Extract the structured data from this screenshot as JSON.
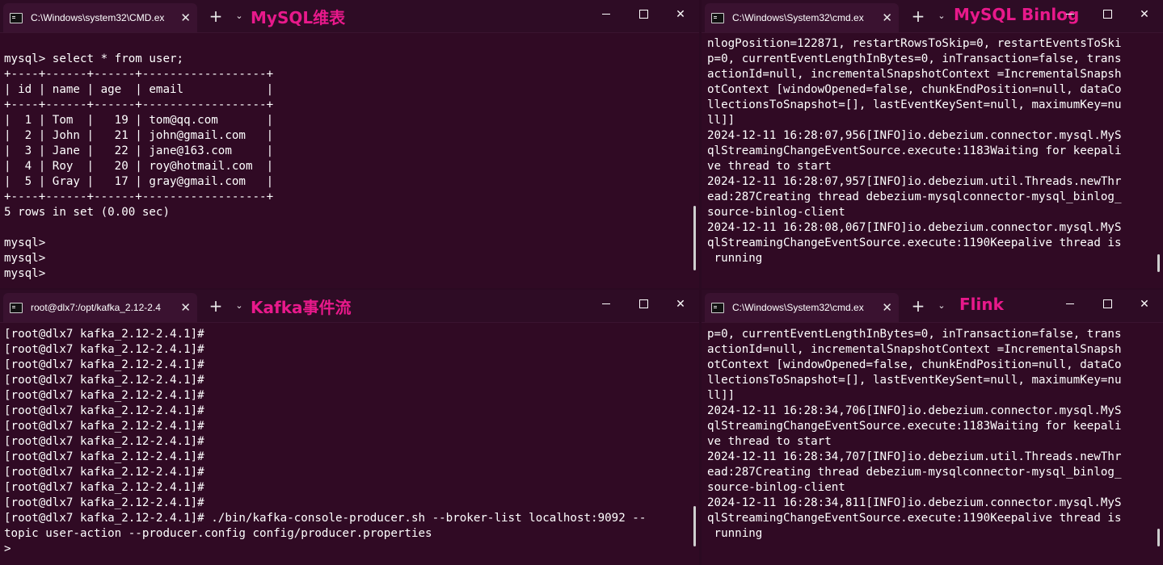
{
  "windows": {
    "mysql": {
      "tab_title": "C:\\Windows\\system32\\CMD.ex",
      "annotation": "MySQL维表",
      "console_lines": [
        "",
        "mysql> select * from user;",
        "+----+------+------+------------------+",
        "| id | name | age  | email            |",
        "+----+------+------+------------------+",
        "|  1 | Tom  |   19 | tom@qq.com       |",
        "|  2 | John |   21 | john@gmail.com   |",
        "|  3 | Jane |   22 | jane@163.com     |",
        "|  4 | Roy  |   20 | roy@hotmail.com  |",
        "|  5 | Gray |   17 | gray@gmail.com   |",
        "+----+------+------+------------------+",
        "5 rows in set (0.00 sec)",
        "",
        "mysql>",
        "mysql>",
        "mysql>"
      ]
    },
    "binlog": {
      "tab_title": "C:\\Windows\\System32\\cmd.ex",
      "annotation": "MySQL Binlog",
      "console_lines": [
        "nlogPosition=122871, restartRowsToSkip=0, restartEventsToSki",
        "p=0, currentEventLengthInBytes=0, inTransaction=false, trans",
        "actionId=null, incrementalSnapshotContext =IncrementalSnapsh",
        "otContext [windowOpened=false, chunkEndPosition=null, dataCo",
        "llectionsToSnapshot=[], lastEventKeySent=null, maximumKey=nu",
        "ll]]",
        "2024-12-11 16:28:07,956[INFO]io.debezium.connector.mysql.MyS",
        "qlStreamingChangeEventSource.execute:1183Waiting for keepali",
        "ve thread to start",
        "2024-12-11 16:28:07,957[INFO]io.debezium.util.Threads.newThr",
        "ead:287Creating thread debezium-mysqlconnector-mysql_binlog_",
        "source-binlog-client",
        "2024-12-11 16:28:08,067[INFO]io.debezium.connector.mysql.MyS",
        "qlStreamingChangeEventSource.execute:1190Keepalive thread is",
        " running"
      ]
    },
    "kafka": {
      "tab_title": "root@dlx7:/opt/kafka_2.12-2.4",
      "annotation": "Kafka事件流",
      "console_lines": [
        "[root@dlx7 kafka_2.12-2.4.1]#",
        "[root@dlx7 kafka_2.12-2.4.1]#",
        "[root@dlx7 kafka_2.12-2.4.1]#",
        "[root@dlx7 kafka_2.12-2.4.1]#",
        "[root@dlx7 kafka_2.12-2.4.1]#",
        "[root@dlx7 kafka_2.12-2.4.1]#",
        "[root@dlx7 kafka_2.12-2.4.1]#",
        "[root@dlx7 kafka_2.12-2.4.1]#",
        "[root@dlx7 kafka_2.12-2.4.1]#",
        "[root@dlx7 kafka_2.12-2.4.1]#",
        "[root@dlx7 kafka_2.12-2.4.1]#",
        "[root@dlx7 kafka_2.12-2.4.1]#",
        "[root@dlx7 kafka_2.12-2.4.1]# ./bin/kafka-console-producer.sh --broker-list localhost:9092 --",
        "topic user-action --producer.config config/producer.properties",
        ">"
      ]
    },
    "flink": {
      "tab_title": "C:\\Windows\\System32\\cmd.ex",
      "annotation": "Flink",
      "console_lines": [
        "p=0, currentEventLengthInBytes=0, inTransaction=false, trans",
        "actionId=null, incrementalSnapshotContext =IncrementalSnapsh",
        "otContext [windowOpened=false, chunkEndPosition=null, dataCo",
        "llectionsToSnapshot=[], lastEventKeySent=null, maximumKey=nu",
        "ll]]",
        "2024-12-11 16:28:34,706[INFO]io.debezium.connector.mysql.MyS",
        "qlStreamingChangeEventSource.execute:1183Waiting for keepali",
        "ve thread to start",
        "2024-12-11 16:28:34,707[INFO]io.debezium.util.Threads.newThr",
        "ead:287Creating thread debezium-mysqlconnector-mysql_binlog_",
        "source-binlog-client",
        "2024-12-11 16:28:34,811[INFO]io.debezium.connector.mysql.MyS",
        "qlStreamingChangeEventSource.execute:1190Keepalive thread is",
        " running"
      ]
    }
  },
  "controls": {
    "new_tab": "+",
    "dropdown": "⌄",
    "tab_close": "✕",
    "close": "✕"
  },
  "icons": [
    "cmd-icon",
    "plus-icon",
    "chevron-down-icon",
    "minimize-icon",
    "maximize-icon",
    "close-icon"
  ],
  "colors": {
    "terminal_bg": "#300a24",
    "titlebar_bg": "#2e0c25",
    "annotation": "#e8198b",
    "text": "#ffffff"
  }
}
